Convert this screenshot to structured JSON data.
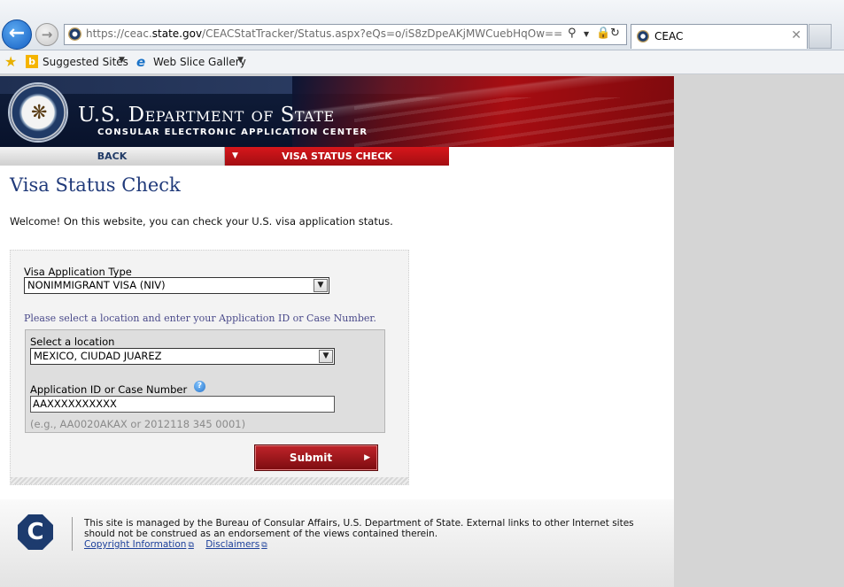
{
  "browser": {
    "url_prefix": "https://ceac.",
    "url_domain": "state.gov",
    "url_path": "/CEACStatTracker/Status.aspx?eQs=o/iS8zDpeAKjMWCuebHqOw==",
    "tab_title": "CEAC",
    "favorites": {
      "suggested_sites": "Suggested Sites",
      "web_slice_gallery": "Web Slice Gallery"
    }
  },
  "banner": {
    "title": "U.S. Department of State",
    "subtitle": "CONSULAR ELECTRONIC APPLICATION CENTER"
  },
  "nav": {
    "back": "BACK",
    "active": "VISA STATUS CHECK"
  },
  "page": {
    "title": "Visa Status Check",
    "welcome": "Welcome! On this website, you can check your U.S. visa application status."
  },
  "form": {
    "visa_type_label": "Visa Application Type",
    "visa_type_value": "NONIMMIGRANT VISA (NIV)",
    "instruction": "Please select a location and enter your Application ID or Case Number.",
    "location_label": "Select a location",
    "location_value": "MEXICO, CIUDAD JUAREZ",
    "appid_label": "Application ID or Case Number",
    "appid_value": "AAXXXXXXXXXX",
    "example": "(e.g., AA0020AKAX or 2012118 345 0001)",
    "submit": "Submit"
  },
  "footer": {
    "text": "This site is managed by the Bureau of Consular Affairs, U.S. Department of State. External links to other Internet sites should not be construed as an endorsement of the views contained therein.",
    "copyright": "Copyright Information",
    "disclaimers": "Disclaimers"
  }
}
